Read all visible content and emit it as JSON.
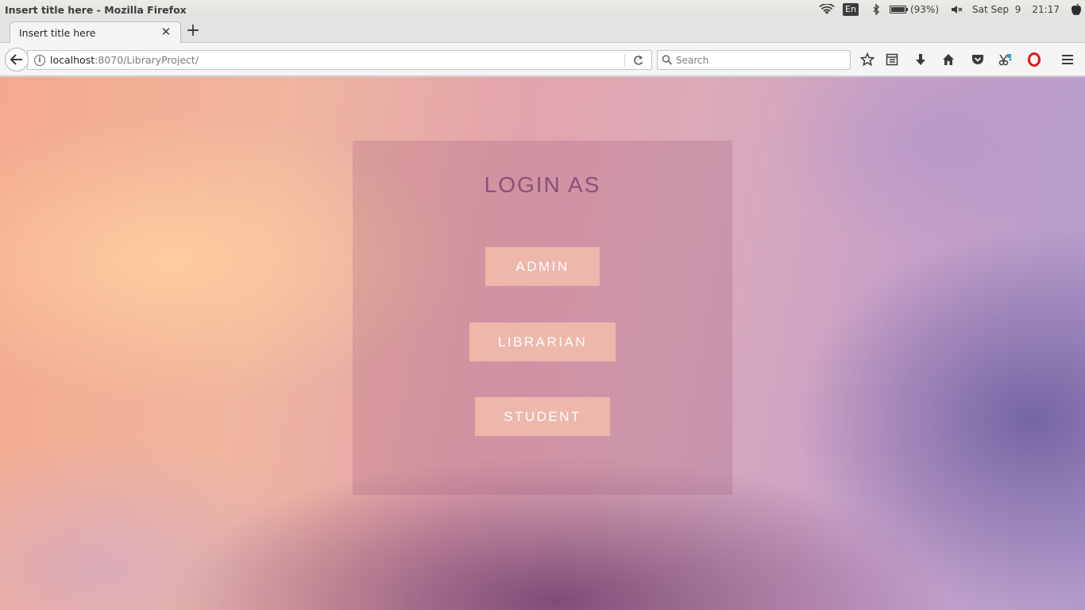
{
  "window": {
    "title": "Insert title here - Mozilla Firefox"
  },
  "system_tray": {
    "icons": [
      "wifi-icon",
      "bluetooth-icon",
      "battery-icon",
      "volume-muted-icon",
      "apple-icon"
    ],
    "keyboard_layout": "En",
    "battery": "(93%)",
    "date": "Sat Sep  9",
    "time": "21:17"
  },
  "tabs": [
    {
      "label": "Insert title here",
      "active": true
    }
  ],
  "navbar": {
    "url_host": "localhost",
    "url_rest": ":8070/LibraryProject/",
    "search_placeholder": "Search",
    "toolbar_icons": [
      "bookmark-star-icon",
      "reading-list-icon",
      "download-icon",
      "home-icon",
      "pocket-icon",
      "screenshot-icon",
      "opera-icon",
      "menu-icon"
    ]
  },
  "login": {
    "title": "LOGIN AS",
    "buttons": {
      "admin": "ADMIN",
      "librarian": "LIBRARIAN",
      "student": "STUDENT"
    }
  },
  "colors": {
    "button_bg": "#eeb7ac",
    "button_text": "#ffffff",
    "title_text": "#8a5078"
  }
}
